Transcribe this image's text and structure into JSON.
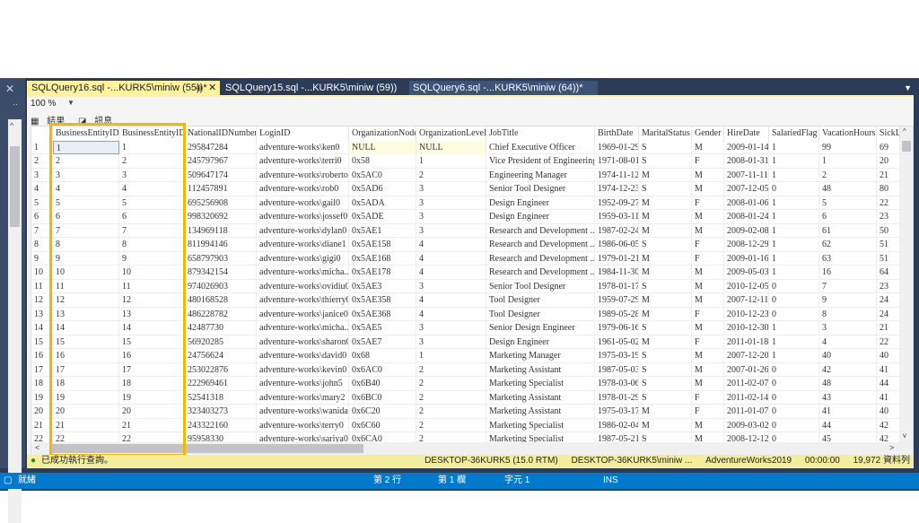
{
  "tabs": [
    {
      "label": "SQLQuery16.sql -...KURK5\\miniw (55))*",
      "active": true,
      "pin": "⊕",
      "close": "✕"
    },
    {
      "label": "SQLQuery15.sql -...KURK5\\miniw (59))"
    },
    {
      "label": "SQLQuery6.sql -...KURK5\\miniw (64))*"
    }
  ],
  "toolbar": {
    "zoom": "100 %"
  },
  "result_tabs": {
    "results": "結果",
    "messages": "訊息"
  },
  "grid": {
    "columns": [
      "",
      "BusinessEntityID",
      "BusinessEntityID",
      "NationalIDNumber",
      "LoginID",
      "OrganizationNode",
      "OrganizationLevel",
      "JobTitle",
      "BirthDate",
      "MaritalStatus",
      "Gender",
      "HireDate",
      "SalariedFlag",
      "VacationHours",
      "SickL"
    ],
    "rows": [
      [
        "1",
        "1",
        "1",
        "295847284",
        "adventure-works\\ken0",
        "NULL",
        "NULL",
        "Chief Executive Officer",
        "1969-01-29",
        "S",
        "M",
        "2009-01-14",
        "1",
        "99",
        "69"
      ],
      [
        "2",
        "2",
        "2",
        "245797967",
        "adventure-works\\terri0",
        "0x58",
        "1",
        "Vice President of Engineering",
        "1971-08-01",
        "S",
        "F",
        "2008-01-31",
        "1",
        "1",
        "20"
      ],
      [
        "3",
        "3",
        "3",
        "509647174",
        "adventure-works\\roberto0",
        "0x5AC0",
        "2",
        "Engineering Manager",
        "1974-11-12",
        "M",
        "M",
        "2007-11-11",
        "1",
        "2",
        "21"
      ],
      [
        "4",
        "4",
        "4",
        "112457891",
        "adventure-works\\rob0",
        "0x5AD6",
        "3",
        "Senior Tool Designer",
        "1974-12-23",
        "S",
        "M",
        "2007-12-05",
        "0",
        "48",
        "80"
      ],
      [
        "5",
        "5",
        "5",
        "695256908",
        "adventure-works\\gail0",
        "0x5ADA",
        "3",
        "Design Engineer",
        "1952-09-27",
        "M",
        "F",
        "2008-01-06",
        "1",
        "5",
        "22"
      ],
      [
        "6",
        "6",
        "6",
        "998320692",
        "adventure-works\\jossef0",
        "0x5ADE",
        "3",
        "Design Engineer",
        "1959-03-11",
        "M",
        "M",
        "2008-01-24",
        "1",
        "6",
        "23"
      ],
      [
        "7",
        "7",
        "7",
        "134969118",
        "adventure-works\\dylan0",
        "0x5AE1",
        "3",
        "Research and Development ...",
        "1987-02-24",
        "M",
        "M",
        "2009-02-08",
        "1",
        "61",
        "50"
      ],
      [
        "8",
        "8",
        "8",
        "811994146",
        "adventure-works\\diane1",
        "0x5AE158",
        "4",
        "Research and Development ...",
        "1986-06-05",
        "S",
        "F",
        "2008-12-29",
        "1",
        "62",
        "51"
      ],
      [
        "9",
        "9",
        "9",
        "658797903",
        "adventure-works\\gigi0",
        "0x5AE168",
        "4",
        "Research and Development ...",
        "1979-01-21",
        "M",
        "F",
        "2009-01-16",
        "1",
        "63",
        "51"
      ],
      [
        "10",
        "10",
        "10",
        "879342154",
        "adventure-works\\micha...",
        "0x5AE178",
        "4",
        "Research and Development ...",
        "1984-11-30",
        "M",
        "M",
        "2009-05-03",
        "1",
        "16",
        "64"
      ],
      [
        "11",
        "11",
        "11",
        "974026903",
        "adventure-works\\ovidiu0",
        "0x5AE3",
        "3",
        "Senior Tool Designer",
        "1978-01-17",
        "S",
        "M",
        "2010-12-05",
        "0",
        "7",
        "23"
      ],
      [
        "12",
        "12",
        "12",
        "480168528",
        "adventure-works\\thierry0",
        "0x5AE358",
        "4",
        "Tool Designer",
        "1959-07-29",
        "M",
        "M",
        "2007-12-11",
        "0",
        "9",
        "24"
      ],
      [
        "13",
        "13",
        "13",
        "486228782",
        "adventure-works\\janice0",
        "0x5AE368",
        "4",
        "Tool Designer",
        "1989-05-28",
        "M",
        "F",
        "2010-12-23",
        "0",
        "8",
        "24"
      ],
      [
        "14",
        "14",
        "14",
        "42487730",
        "adventure-works\\micha...",
        "0x5AE5",
        "3",
        "Senior Design Engineer",
        "1979-06-16",
        "S",
        "M",
        "2010-12-30",
        "1",
        "3",
        "21"
      ],
      [
        "15",
        "15",
        "15",
        "56920285",
        "adventure-works\\sharon0",
        "0x5AE7",
        "3",
        "Design Engineer",
        "1961-05-02",
        "M",
        "F",
        "2011-01-18",
        "1",
        "4",
        "22"
      ],
      [
        "16",
        "16",
        "16",
        "24756624",
        "adventure-works\\david0",
        "0x68",
        "1",
        "Marketing Manager",
        "1975-03-19",
        "S",
        "M",
        "2007-12-20",
        "1",
        "40",
        "40"
      ],
      [
        "17",
        "17",
        "17",
        "253022876",
        "adventure-works\\kevin0",
        "0x6AC0",
        "2",
        "Marketing Assistant",
        "1987-05-03",
        "S",
        "M",
        "2007-01-26",
        "0",
        "42",
        "41"
      ],
      [
        "18",
        "18",
        "18",
        "222969461",
        "adventure-works\\john5",
        "0x6B40",
        "2",
        "Marketing Specialist",
        "1978-03-06",
        "S",
        "M",
        "2011-02-07",
        "0",
        "48",
        "44"
      ],
      [
        "19",
        "19",
        "19",
        "52541318",
        "adventure-works\\mary2",
        "0x6BC0",
        "2",
        "Marketing Assistant",
        "1978-01-29",
        "S",
        "F",
        "2011-02-14",
        "0",
        "43",
        "41"
      ],
      [
        "20",
        "20",
        "20",
        "323403273",
        "adventure-works\\wanida0",
        "0x6C20",
        "2",
        "Marketing Assistant",
        "1975-03-17",
        "M",
        "F",
        "2011-01-07",
        "0",
        "41",
        "40"
      ],
      [
        "21",
        "21",
        "21",
        "243322160",
        "adventure-works\\terry0",
        "0x6C60",
        "2",
        "Marketing Specialist",
        "1986-02-04",
        "M",
        "M",
        "2009-03-02",
        "0",
        "44",
        "42"
      ],
      [
        "22",
        "22",
        "22",
        "95958330",
        "adventure-works\\sariya0",
        "0x6CA0",
        "2",
        "Marketing Specialist",
        "1987-05-21",
        "S",
        "M",
        "2008-12-12",
        "0",
        "45",
        "42"
      ]
    ]
  },
  "query_status": {
    "message": "已成功執行查詢。",
    "server": "DESKTOP-36KURK5 (15.0 RTM)",
    "user": "DESKTOP-36KURK5\\miniw ...",
    "database": "AdventureWorks2019",
    "time": "00:00:00",
    "rows": "19,972 資料列"
  },
  "app_status": {
    "ready": "就緒",
    "line": "第 2 行",
    "col": "第 1 欄",
    "char": "字元 1",
    "mode": "INS"
  },
  "colors": {
    "accent": "#007acc",
    "highlight": "#f5b800",
    "active_tab": "#fff29d"
  }
}
